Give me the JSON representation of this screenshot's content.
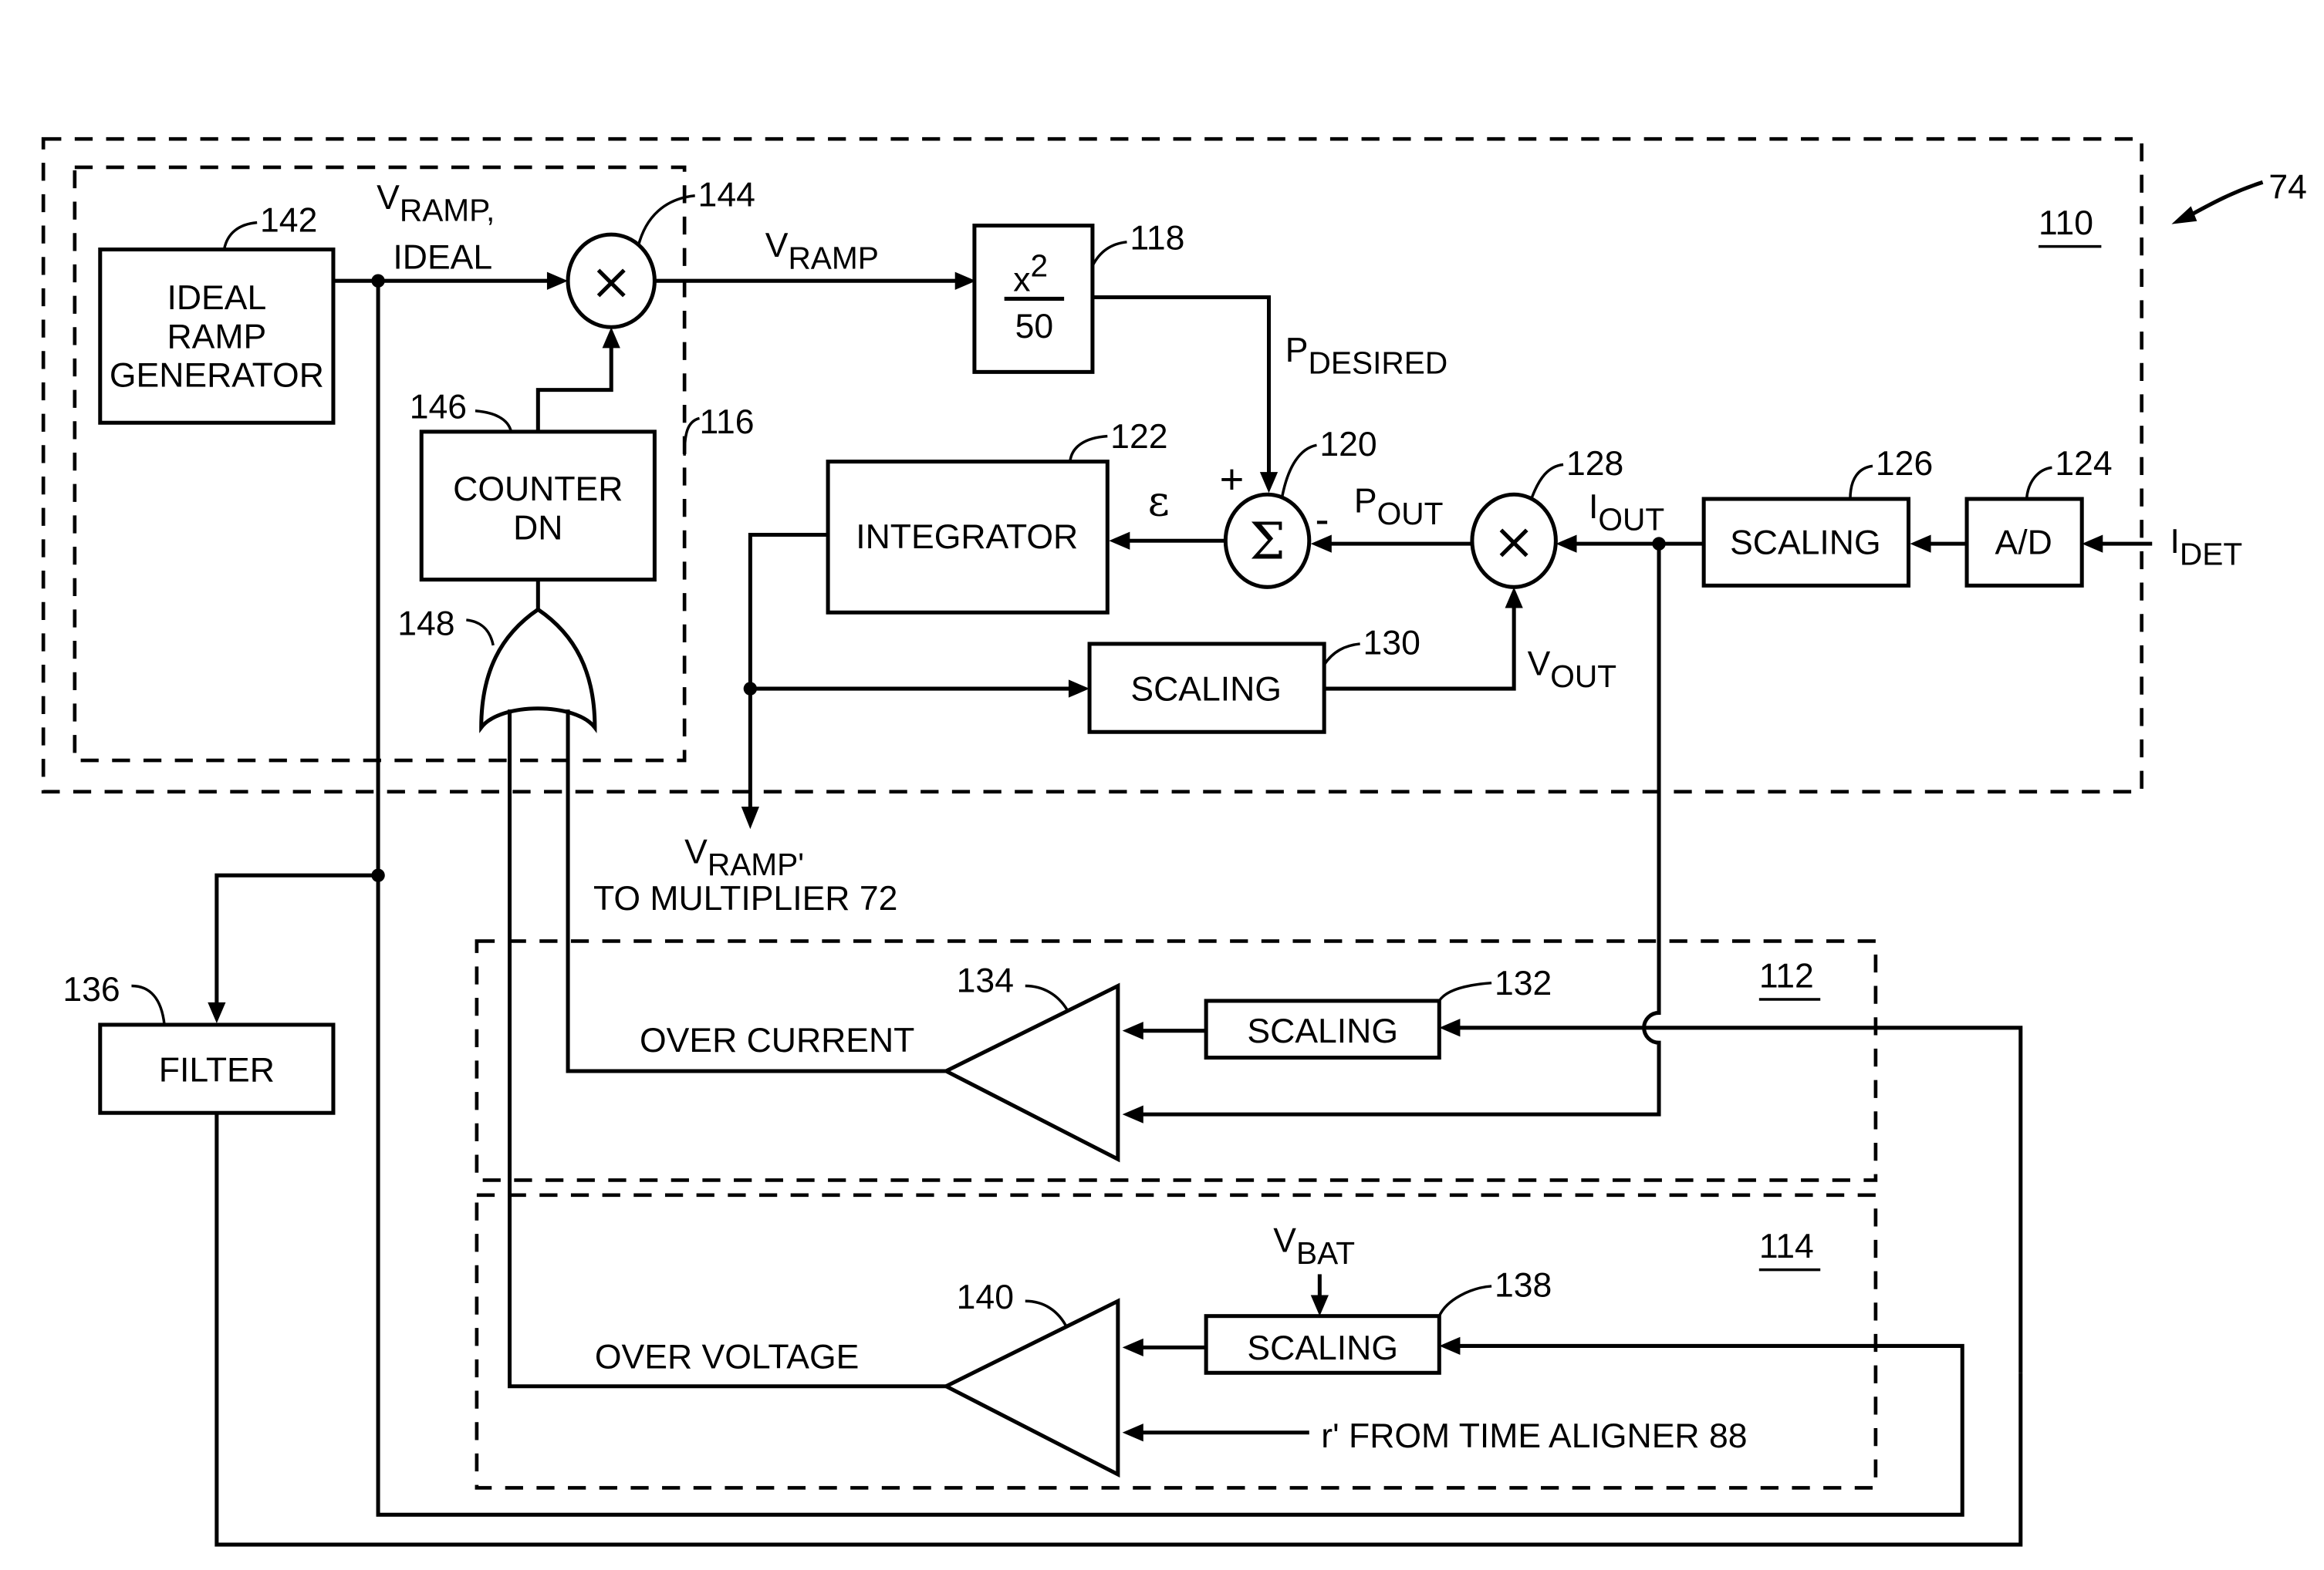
{
  "figure": {
    "ref_number": "74",
    "regions": {
      "main": "110",
      "over_current": "112",
      "over_voltage": "114",
      "ramp_sub": "116"
    }
  },
  "blocks": {
    "ideal_ramp_generator": {
      "ref": "142",
      "lines": [
        "IDEAL",
        "RAMP",
        "GENERATOR"
      ]
    },
    "multiplier_144": {
      "ref": "144",
      "symbol": "×"
    },
    "counter_dn": {
      "ref": "146",
      "lines": [
        "COUNTER",
        "DN"
      ]
    },
    "or_gate": {
      "ref": "148"
    },
    "squarer": {
      "ref": "118",
      "numerator": "x",
      "exponent": "2",
      "denominator": "50"
    },
    "summer": {
      "ref": "120",
      "symbol": "Σ",
      "plus": "+",
      "minus": "-"
    },
    "integrator": {
      "ref": "122",
      "label": "INTEGRATOR"
    },
    "multiplier_128": {
      "ref": "128",
      "symbol": "×"
    },
    "scaling_126": {
      "ref": "126",
      "label": "SCALING"
    },
    "ad": {
      "ref": "124",
      "label": "A/D"
    },
    "scaling_130": {
      "ref": "130",
      "label": "SCALING"
    },
    "filter": {
      "ref": "136",
      "label": "FILTER"
    },
    "scaling_132": {
      "ref": "132",
      "label": "SCALING"
    },
    "comparator_134": {
      "ref": "134",
      "label": "OVER CURRENT"
    },
    "scaling_138": {
      "ref": "138",
      "label": "SCALING"
    },
    "comparator_140": {
      "ref": "140",
      "label": "OVER VOLTAGE"
    }
  },
  "signals": {
    "v_ramp_ideal": {
      "main": "V",
      "sub": "RAMP,",
      "line2": "IDEAL"
    },
    "v_ramp": {
      "main": "V",
      "sub": "RAMP"
    },
    "p_desired": {
      "main": "P",
      "sub": "DESIRED"
    },
    "epsilon": "ε",
    "p_out": {
      "main": "P",
      "sub": "OUT"
    },
    "i_out": {
      "main": "I",
      "sub": "OUT"
    },
    "i_det": {
      "main": "I",
      "sub": "DET"
    },
    "v_out": {
      "main": "V",
      "sub": "OUT"
    },
    "v_ramp_prime": {
      "main": "V",
      "sub": "RAMP'",
      "line2": "TO MULTIPLIER 72"
    },
    "v_bat": {
      "main": "V",
      "sub": "BAT"
    },
    "r_prime": "r'  FROM TIME ALIGNER 88"
  }
}
